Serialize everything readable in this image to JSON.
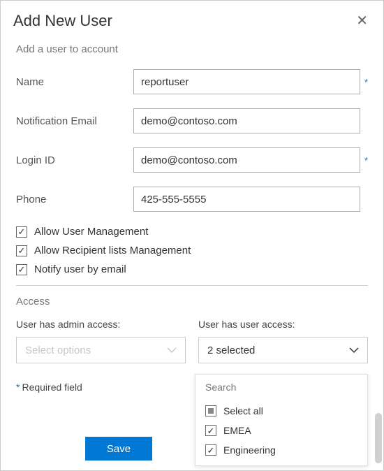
{
  "header": {
    "title": "Add New User"
  },
  "subtitle": "Add a user to account",
  "fields": {
    "name": {
      "label": "Name",
      "value": "reportuser",
      "required": true
    },
    "email": {
      "label": "Notification Email",
      "value": "demo@contoso.com",
      "required": false
    },
    "login": {
      "label": "Login ID",
      "value": "demo@contoso.com",
      "required": true
    },
    "phone": {
      "label": "Phone",
      "value": "425-555-5555",
      "required": false
    }
  },
  "checkboxes": {
    "allow_user_mgmt": {
      "label": "Allow User Management",
      "checked": true
    },
    "allow_recipient_mgmt": {
      "label": "Allow Recipient lists Management",
      "checked": true
    },
    "notify_email": {
      "label": "Notify user by email",
      "checked": true
    }
  },
  "access": {
    "section_title": "Access",
    "admin": {
      "label": "User has admin access:",
      "placeholder": "Select options"
    },
    "user": {
      "label": "User has user access:",
      "selected_text": "2 selected",
      "search_placeholder": "Search",
      "options": {
        "select_all": {
          "label": "Select all",
          "state": "partial"
        },
        "emea": {
          "label": "EMEA",
          "checked": true
        },
        "engineering": {
          "label": "Engineering",
          "checked": true
        }
      }
    }
  },
  "required_note": "Required field",
  "buttons": {
    "save": "Save"
  }
}
